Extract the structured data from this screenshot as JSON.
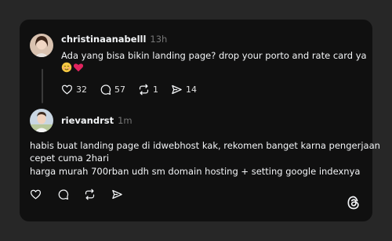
{
  "post1": {
    "username": "christinaanabelll",
    "time": "13h",
    "line1": "Ada yang bisa bikin landing page? drop your porto and rate card ya",
    "emojis": "😊❤️",
    "likes": "32",
    "comments": "57",
    "reposts": "1",
    "shares": "14"
  },
  "post2": {
    "username": "rievandrst",
    "time": "1m",
    "line1": "habis buat landing page di idwebhost kak, rekomen banget karna pengerjaan",
    "line2": "cepet cuma 2hari",
    "line3": "harga murah 700rban udh sm domain hosting + setting google indexnya"
  },
  "icons": {
    "like": "heart-icon",
    "comment": "comment-icon",
    "repost": "repost-icon",
    "share": "send-icon",
    "brand": "threads-logo-icon"
  },
  "colors": {
    "background": "#272727",
    "card": "#101010",
    "text": "#f3f5f7",
    "muted": "#777777",
    "heart_emoji": "#e0245e",
    "smile_emoji": "#f5c842"
  }
}
